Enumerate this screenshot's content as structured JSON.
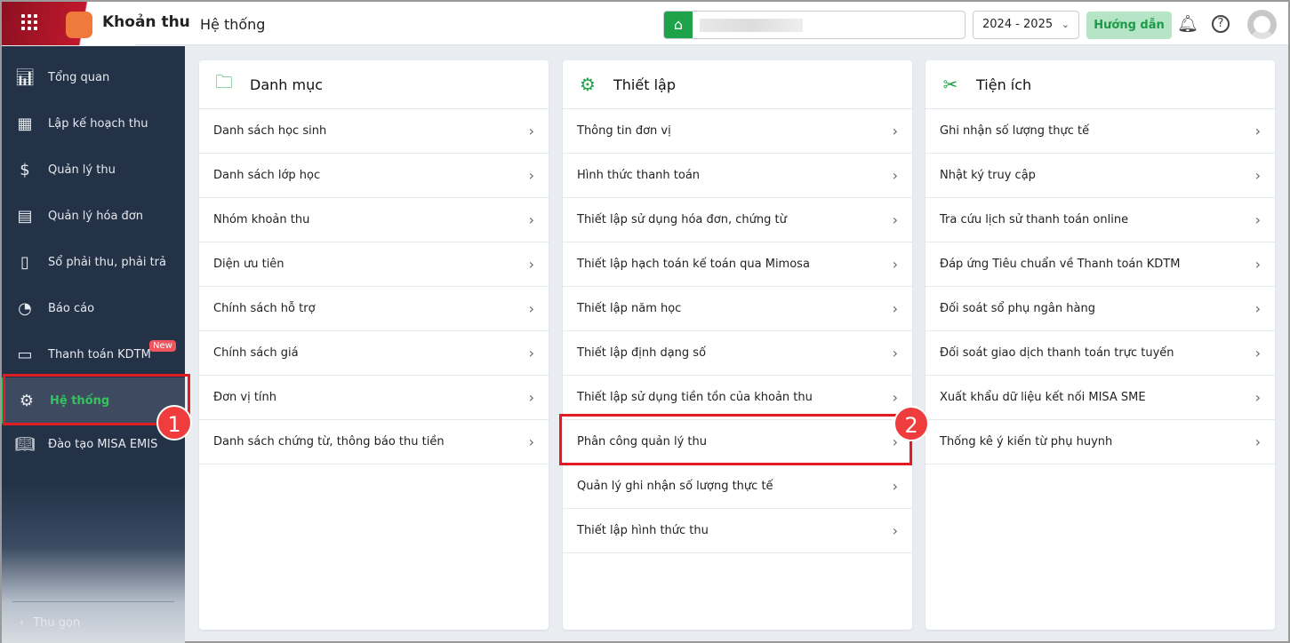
{
  "header": {
    "app_title": "Khoản thu",
    "module_title": "Hệ thống",
    "school_year": "2024 - 2025",
    "guide_label": "Hướng dẫn"
  },
  "sidebar": {
    "items": [
      {
        "label": "Tổng quan",
        "icon": "bar-chart-icon"
      },
      {
        "label": "Lập kế hoạch thu",
        "icon": "calendar-money-icon"
      },
      {
        "label": "Quản lý thu",
        "icon": "hand-coin-icon"
      },
      {
        "label": "Quản lý hóa đơn",
        "icon": "invoice-icon"
      },
      {
        "label": "Sổ phải thu, phải trả",
        "icon": "ledger-icon"
      },
      {
        "label": "Báo cáo",
        "icon": "pie-chart-icon"
      },
      {
        "label": "Thanh toán KDTM",
        "icon": "card-check-icon"
      },
      {
        "label": "Hệ thống",
        "icon": "gear-icon"
      },
      {
        "label": "Đào tạo MISA EMIS",
        "icon": "book-icon"
      }
    ],
    "new_badge": "New",
    "collapse_label": "Thu gọn"
  },
  "cards": [
    {
      "title": "Danh mục",
      "items": [
        "Danh sách học sinh",
        "Danh sách lớp học",
        "Nhóm khoản thu",
        "Diện ưu tiên",
        "Chính sách hỗ trợ",
        "Chính sách giá",
        "Đơn vị tính",
        "Danh sách chứng từ, thông báo thu tiền"
      ]
    },
    {
      "title": "Thiết lập",
      "items": [
        "Thông tin đơn vị",
        "Hình thức thanh toán",
        "Thiết lập sử dụng hóa đơn, chứng từ",
        "Thiết lập hạch toán kế toán qua Mimosa",
        "Thiết lập năm học",
        "Thiết lập định dạng số",
        "Thiết lập sử dụng tiền tồn của khoản thu",
        "Phân công quản lý thu",
        "Quản lý ghi nhận số lượng thực tế",
        "Thiết lập hình thức thu"
      ]
    },
    {
      "title": "Tiện ích",
      "items": [
        "Ghi nhận số lượng thực tế",
        "Nhật ký truy cập",
        "Tra cứu lịch sử thanh toán online",
        "Đáp ứng Tiêu chuẩn về Thanh toán KDTM",
        "Đối soát sổ phụ ngân hàng",
        "Đối soát giao dịch thanh toán trực tuyến",
        "Xuất khẩu dữ liệu kết nối MISA SME",
        "Thống kê ý kiến từ phụ huynh"
      ]
    }
  ],
  "annotations": [
    "1",
    "2"
  ]
}
